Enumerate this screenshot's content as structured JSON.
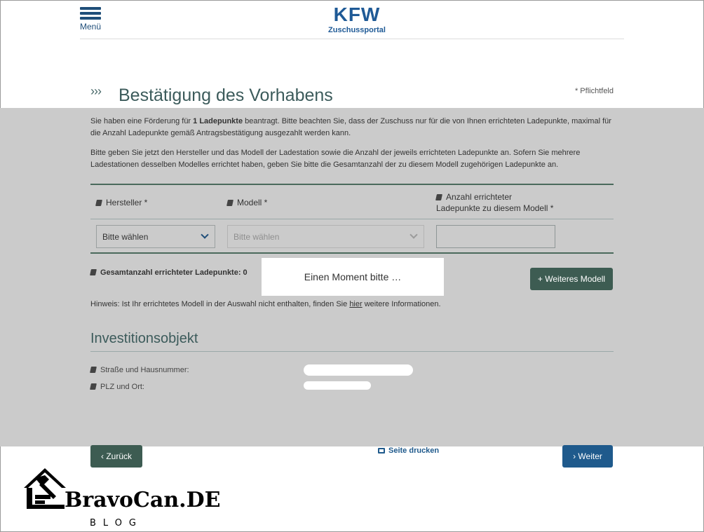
{
  "header": {
    "menu_label": "Menü",
    "logo_text": "KFW",
    "logo_subtitle": "Zuschussportal"
  },
  "page": {
    "chevrons": "›››",
    "title": "Bestätigung des Vorhabens",
    "required_note": "* Pflichtfeld"
  },
  "intro": {
    "p1_before": "Sie haben eine Förderung für ",
    "p1_bold": "1 Ladepunkte",
    "p1_after": " beantragt. Bitte beachten Sie, dass der Zuschuss nur für die von Ihnen errichteten Ladepunkte, maximal für die Anzahl Ladepunkte gemäß Antragsbestätigung ausgezahlt werden kann.",
    "p2": "Bitte geben Sie jetzt den Hersteller und das Modell der Ladestation sowie die Anzahl der jeweils errichteten Ladepunkte an. Sofern Sie mehrere Ladestationen desselben Modelles errichtet haben, geben Sie bitte die Gesamtanzahl der zu diesem Modell zugehörigen Ladepunkte an."
  },
  "table": {
    "col_manufacturer": "Hersteller *",
    "col_model": "Modell *",
    "col_count_line1": "Anzahl errichteter",
    "col_count_line2": "Ladepunkte zu diesem Modell *",
    "manufacturer_select": "Bitte wählen",
    "model_select": "Bitte wählen",
    "count_value": ""
  },
  "total": {
    "label": "Gesamtanzahl errichteter Ladepunkte: 0"
  },
  "loading": {
    "text": "Einen Moment bitte …"
  },
  "add_model_button": "+ Weiteres Modell",
  "hint": {
    "before": "Hinweis: Ist Ihr errichtetes Modell in der Auswahl nicht enthalten, finden Sie ",
    "link": "hier",
    "after": " weitere Informationen."
  },
  "investment": {
    "title": "Investitionsobjekt",
    "street_label": "Straße und Hausnummer:",
    "city_label": "PLZ und Ort:"
  },
  "footer": {
    "back_label": "‹  Zurück",
    "print_label": "Seite drucken",
    "next_label": "›  Weiter"
  },
  "watermark": {
    "brand": "BravoCan.DE",
    "tagline": "BLOG"
  },
  "colors": {
    "brand_blue": "#1f5a96",
    "primary_green": "#3d5c52",
    "overlay_grey": "#cbcbcb"
  }
}
